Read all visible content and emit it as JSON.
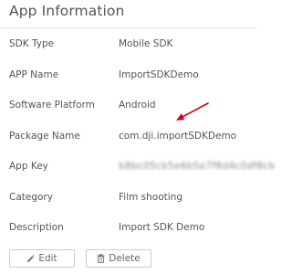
{
  "panel": {
    "title": "App Information"
  },
  "rows": [
    {
      "label": "SDK Type",
      "value": "Mobile SDK"
    },
    {
      "label": "APP Name",
      "value": "ImportSDKDemo"
    },
    {
      "label": "Software Platform",
      "value": "Android"
    },
    {
      "label": "Package Name",
      "value": "com.dji.importSDKDemo"
    },
    {
      "label": "App Key",
      "value": "b8bc05cb5e6b5e7f8d4c0df8cb"
    },
    {
      "label": "Category",
      "value": "Film shooting"
    },
    {
      "label": "Description",
      "value": "Import SDK Demo"
    }
  ],
  "actions": {
    "edit_label": "Edit",
    "delete_label": "Delete"
  },
  "icons": {
    "edit": "pencil-icon",
    "delete": "trash-icon",
    "annotation": "red-arrow-icon"
  },
  "colors": {
    "annotation_arrow": "#d0021b",
    "text": "#555555",
    "border": "#cccccc"
  }
}
